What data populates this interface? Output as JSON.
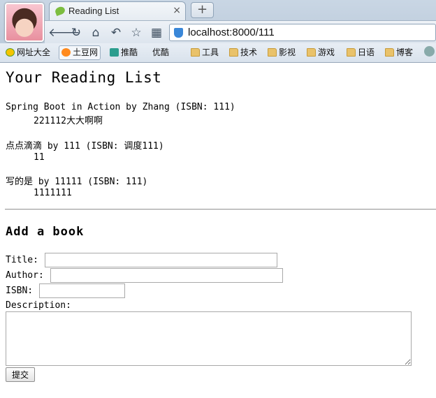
{
  "browser": {
    "tab_title": "Reading List",
    "tab_close": "×",
    "new_tab": "+",
    "url": "localhost:8000/111",
    "bookmarks": [
      {
        "label": "网址大全",
        "icon": "globe-icon"
      },
      {
        "label": "土豆网",
        "icon": "tudou-icon"
      },
      {
        "label": "推酷",
        "icon": "tuiku-icon"
      },
      {
        "label": "优酷",
        "icon": "page-icon"
      },
      {
        "label": "工具",
        "icon": "folder-icon"
      },
      {
        "label": "技术",
        "icon": "folder-icon"
      },
      {
        "label": "影视",
        "icon": "folder-icon"
      },
      {
        "label": "游戏",
        "icon": "folder-icon"
      },
      {
        "label": "日语",
        "icon": "folder-icon"
      },
      {
        "label": "博客",
        "icon": "folder-icon"
      }
    ]
  },
  "page": {
    "heading": "Your Reading List",
    "books": [
      {
        "line": "Spring Boot in Action by Zhang (ISBN: 111)",
        "description": "221112大大啊啊"
      },
      {
        "line": "点点滴滴 by 111 (ISBN: 调度111)",
        "description": "11"
      },
      {
        "line": "写的是 by 11111 (ISBN: 111)",
        "description": "1111111"
      }
    ],
    "form": {
      "heading": "Add a book",
      "title_label": "Title:",
      "author_label": "Author:",
      "isbn_label": "ISBN:",
      "description_label": "Description:",
      "submit_label": "提交",
      "title_value": "",
      "author_value": "",
      "isbn_value": "",
      "description_value": ""
    }
  }
}
